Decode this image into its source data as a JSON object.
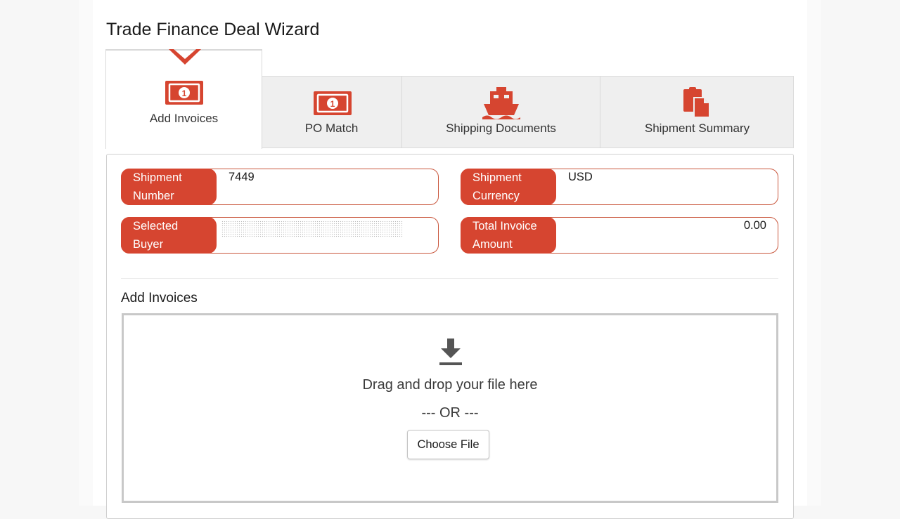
{
  "title": "Trade Finance Deal Wizard",
  "accent_color": "#d64530",
  "tabs": [
    {
      "label": "Add Invoices",
      "icon": "money-bill-icon",
      "active": true
    },
    {
      "label": "PO Match",
      "icon": "money-bill-icon",
      "active": false
    },
    {
      "label": "Shipping Documents",
      "icon": "ship-icon",
      "active": false
    },
    {
      "label": "Shipment Summary",
      "icon": "documents-icon",
      "active": false
    }
  ],
  "fields": {
    "shipment_number": {
      "label_line1": "Shipment",
      "label_line2": "Number",
      "value": "7449"
    },
    "shipment_currency": {
      "label_line1": "Shipment",
      "label_line2": "Currency",
      "value": "USD"
    },
    "selected_buyer": {
      "label_line1": "Selected",
      "label_line2": "Buyer",
      "value": ""
    },
    "total_invoice_amount": {
      "label_line1": "Total Invoice",
      "label_line2": "Amount",
      "value": "0.00"
    }
  },
  "add_invoices": {
    "section_title": "Add Invoices",
    "drop_text": "Drag and drop your file here",
    "or_text": "--- OR ---",
    "choose_file_label": "Choose File"
  }
}
